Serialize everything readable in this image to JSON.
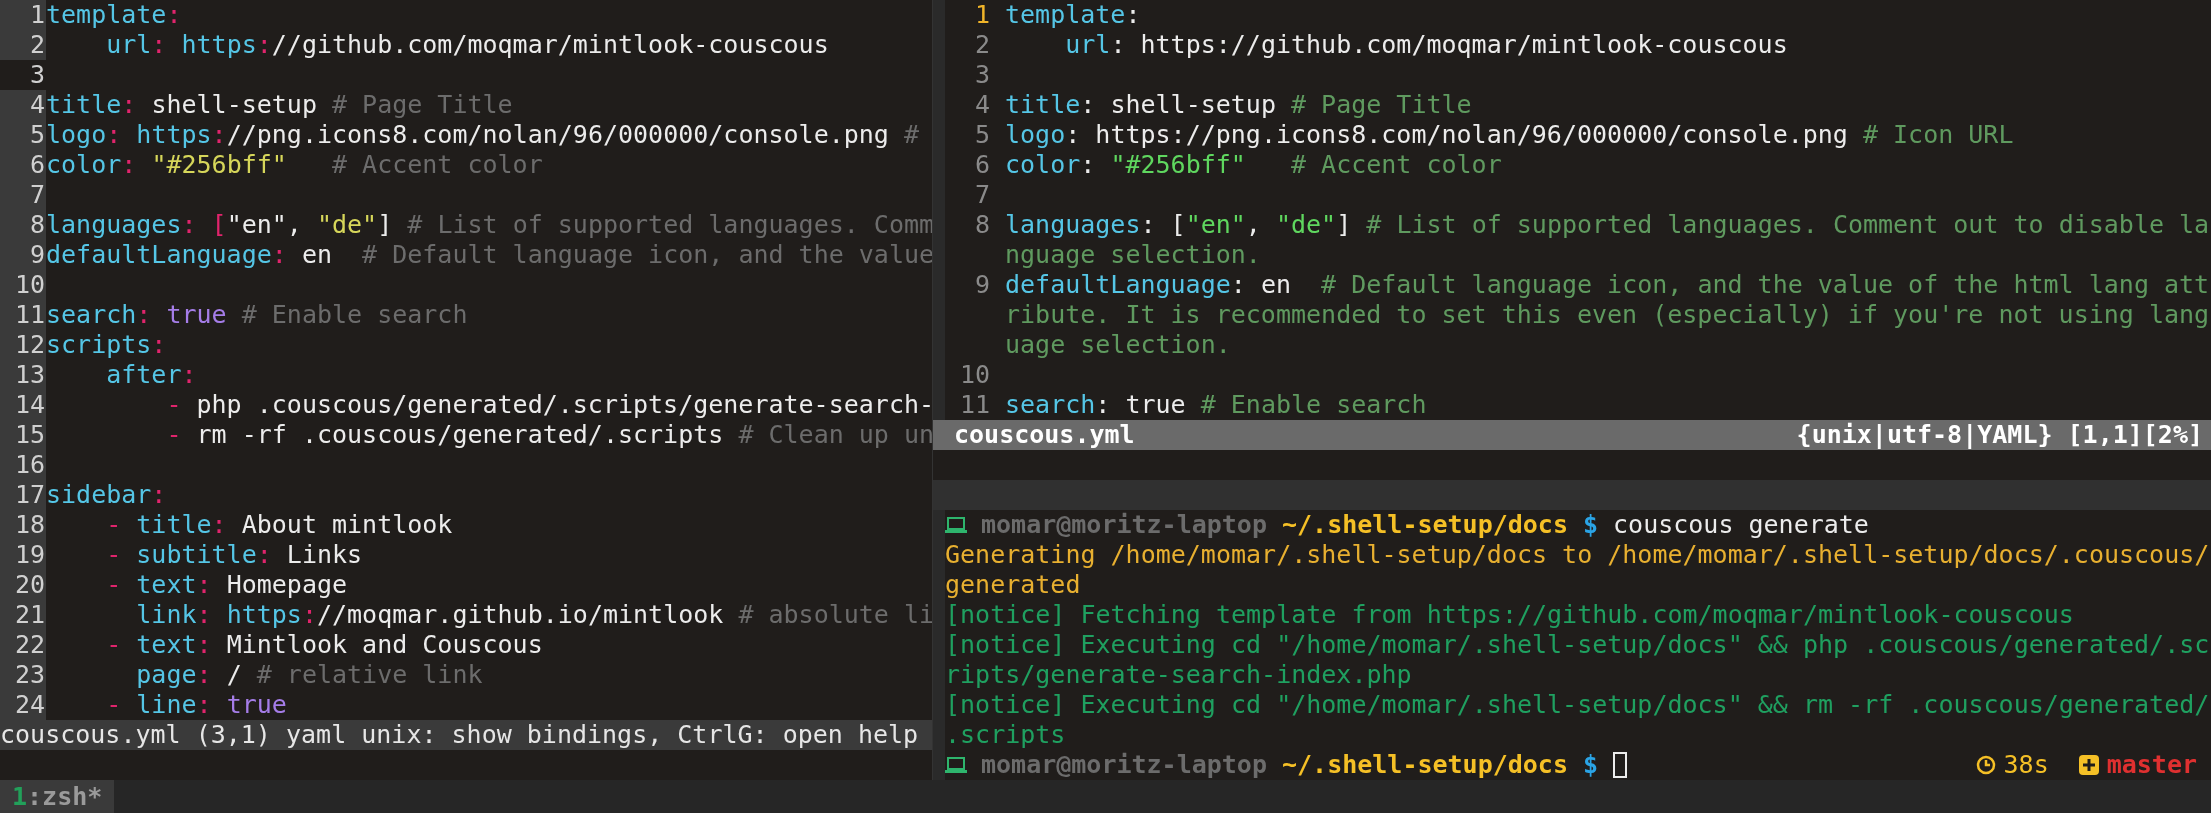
{
  "left_editor": {
    "lines": [
      {
        "number": "1",
        "current": false,
        "tokens": [
          {
            "kind": "key",
            "text": "template"
          },
          {
            "kind": "punct",
            "text": ":"
          }
        ]
      },
      {
        "number": "2",
        "current": false,
        "tokens": [
          {
            "kind": "key",
            "text": "    url"
          },
          {
            "kind": "punct",
            "text": ":"
          },
          {
            "kind": "key",
            "text": " https"
          },
          {
            "kind": "punct",
            "text": ":"
          },
          {
            "kind": "text",
            "text": "//github.com/moqmar/mintlook-couscous"
          }
        ]
      },
      {
        "number": "3",
        "current": true
      },
      {
        "number": "4",
        "current": false,
        "tokens": [
          {
            "kind": "key",
            "text": "title"
          },
          {
            "kind": "punct",
            "text": ":"
          },
          {
            "kind": "text",
            "text": " shell-setup "
          },
          {
            "kind": "comment",
            "text": "# Page Title"
          }
        ]
      },
      {
        "number": "5",
        "current": false,
        "tokens": [
          {
            "kind": "key",
            "text": "logo"
          },
          {
            "kind": "punct",
            "text": ":"
          },
          {
            "kind": "key",
            "text": " https"
          },
          {
            "kind": "punct",
            "text": ":"
          },
          {
            "kind": "text",
            "text": "//png.icons8.com/nolan/96/000000/console.png "
          },
          {
            "kind": "comment",
            "text": "#"
          }
        ]
      },
      {
        "number": "6",
        "current": false,
        "tokens": [
          {
            "kind": "key",
            "text": "color"
          },
          {
            "kind": "punct",
            "text": ":"
          },
          {
            "kind": "string",
            "text": " \"#256bff\""
          },
          {
            "kind": "comment",
            "text": "   # Accent color"
          }
        ]
      },
      {
        "number": "7",
        "current": false
      },
      {
        "number": "8",
        "current": false,
        "tokens": [
          {
            "kind": "key",
            "text": "languages"
          },
          {
            "kind": "punct",
            "text": ":"
          },
          {
            "kind": "punct",
            "text": " ["
          },
          {
            "kind": "text",
            "text": "\"en\", "
          },
          {
            "kind": "string",
            "text": "\"de\""
          },
          {
            "kind": "text",
            "text": "] "
          },
          {
            "kind": "comment",
            "text": "# List of supported languages. Comm"
          }
        ]
      },
      {
        "number": "9",
        "current": false,
        "tokens": [
          {
            "kind": "key",
            "text": "defaultLanguage"
          },
          {
            "kind": "punct",
            "text": ":"
          },
          {
            "kind": "text",
            "text": " en  "
          },
          {
            "kind": "comment",
            "text": "# Default language icon, and the value"
          }
        ]
      },
      {
        "number": "10",
        "current": false
      },
      {
        "number": "11",
        "current": false,
        "tokens": [
          {
            "kind": "key",
            "text": "search"
          },
          {
            "kind": "punct",
            "text": ":"
          },
          {
            "kind": "bool",
            "text": " true"
          },
          {
            "kind": "comment",
            "text": " # Enable search"
          }
        ]
      },
      {
        "number": "12",
        "current": false,
        "tokens": [
          {
            "kind": "key",
            "text": "scripts"
          },
          {
            "kind": "punct",
            "text": ":"
          }
        ]
      },
      {
        "number": "13",
        "current": false,
        "tokens": [
          {
            "kind": "key",
            "text": "    after"
          },
          {
            "kind": "punct",
            "text": ":"
          }
        ]
      },
      {
        "number": "14",
        "current": false,
        "tokens": [
          {
            "kind": "punct",
            "text": "        -"
          },
          {
            "kind": "text",
            "text": " php .couscous/generated/.scripts/generate-search-"
          }
        ]
      },
      {
        "number": "15",
        "current": false,
        "tokens": [
          {
            "kind": "punct",
            "text": "        -"
          },
          {
            "kind": "text",
            "text": " rm -rf .couscous/generated/.scripts "
          },
          {
            "kind": "comment",
            "text": "# Clean up un"
          }
        ]
      },
      {
        "number": "16",
        "current": false
      },
      {
        "number": "17",
        "current": false,
        "tokens": [
          {
            "kind": "key",
            "text": "sidebar"
          },
          {
            "kind": "punct",
            "text": ":"
          }
        ]
      },
      {
        "number": "18",
        "current": false,
        "tokens": [
          {
            "kind": "punct",
            "text": "    -"
          },
          {
            "kind": "key",
            "text": " title"
          },
          {
            "kind": "punct",
            "text": ":"
          },
          {
            "kind": "text",
            "text": " About mintlook"
          }
        ]
      },
      {
        "number": "19",
        "current": false,
        "tokens": [
          {
            "kind": "punct",
            "text": "    -"
          },
          {
            "kind": "key",
            "text": " subtitle"
          },
          {
            "kind": "punct",
            "text": ":"
          },
          {
            "kind": "text",
            "text": " Links"
          }
        ]
      },
      {
        "number": "20",
        "current": false,
        "tokens": [
          {
            "kind": "punct",
            "text": "    -"
          },
          {
            "kind": "key",
            "text": " text"
          },
          {
            "kind": "punct",
            "text": ":"
          },
          {
            "kind": "text",
            "text": " Homepage"
          }
        ]
      },
      {
        "number": "21",
        "current": false,
        "tokens": [
          {
            "kind": "key",
            "text": "      link"
          },
          {
            "kind": "punct",
            "text": ":"
          },
          {
            "kind": "key",
            "text": " https"
          },
          {
            "kind": "punct",
            "text": ":"
          },
          {
            "kind": "text",
            "text": "//moqmar.github.io/mintlook "
          },
          {
            "kind": "comment",
            "text": "# absolute li"
          }
        ]
      },
      {
        "number": "22",
        "current": false,
        "tokens": [
          {
            "kind": "punct",
            "text": "    -"
          },
          {
            "kind": "key",
            "text": " text"
          },
          {
            "kind": "punct",
            "text": ":"
          },
          {
            "kind": "text",
            "text": " Mintlook and Couscous"
          }
        ]
      },
      {
        "number": "23",
        "current": false,
        "tokens": [
          {
            "kind": "key",
            "text": "      page"
          },
          {
            "kind": "punct",
            "text": ":"
          },
          {
            "kind": "text",
            "text": " / "
          },
          {
            "kind": "comment",
            "text": "# relative link"
          }
        ]
      },
      {
        "number": "24",
        "current": false,
        "tokens": [
          {
            "kind": "punct",
            "text": "    -"
          },
          {
            "kind": "key",
            "text": " line"
          },
          {
            "kind": "punct",
            "text": ":"
          },
          {
            "kind": "bool",
            "text": " true"
          }
        ]
      }
    ],
    "status": "couscous.yml (3,1) yaml unix: show bindings, CtrlG: open help"
  },
  "right_editor": {
    "lines": [
      {
        "number": "1",
        "current": true,
        "tokens": [
          {
            "kind": "key",
            "text": "template"
          },
          {
            "kind": "punct",
            "text": ":"
          }
        ]
      },
      {
        "number": "2",
        "current": false,
        "tokens": [
          {
            "kind": "key",
            "text": "    url"
          },
          {
            "kind": "punct",
            "text": ":"
          },
          {
            "kind": "text",
            "text": " https://github.com/moqmar/mintlook-couscous"
          }
        ]
      },
      {
        "number": "3",
        "current": false
      },
      {
        "number": "4",
        "current": false,
        "tokens": [
          {
            "kind": "key",
            "text": "title"
          },
          {
            "kind": "punct",
            "text": ":"
          },
          {
            "kind": "text",
            "text": " shell-setup "
          },
          {
            "kind": "comment",
            "text": "# Page Title"
          }
        ]
      },
      {
        "number": "5",
        "current": false,
        "tokens": [
          {
            "kind": "key",
            "text": "logo"
          },
          {
            "kind": "punct",
            "text": ":"
          },
          {
            "kind": "text",
            "text": " https://png.icons8.com/nolan/96/000000/console.png "
          },
          {
            "kind": "comment",
            "text": "# Icon URL"
          }
        ]
      },
      {
        "number": "6",
        "current": false,
        "tokens": [
          {
            "kind": "key",
            "text": "color"
          },
          {
            "kind": "punct",
            "text": ":"
          },
          {
            "kind": "string",
            "text": " \"#256bff\""
          },
          {
            "kind": "comment",
            "text": "   # Accent color"
          }
        ]
      },
      {
        "number": "7",
        "current": false
      },
      {
        "number": "8",
        "current": false,
        "tokens": [
          {
            "kind": "key",
            "text": "languages"
          },
          {
            "kind": "punct",
            "text": ":"
          },
          {
            "kind": "text",
            "text": " ["
          },
          {
            "kind": "string",
            "text": "\"en\""
          },
          {
            "kind": "text",
            "text": ", "
          },
          {
            "kind": "string",
            "text": "\"de\""
          },
          {
            "kind": "text",
            "text": "] "
          },
          {
            "kind": "comment",
            "text": "# List of supported languages. Comment out to disable language selection."
          }
        ]
      },
      {
        "number": "9",
        "current": false,
        "tokens": [
          {
            "kind": "key",
            "text": "defaultLanguage"
          },
          {
            "kind": "punct",
            "text": ":"
          },
          {
            "kind": "text",
            "text": " en  "
          },
          {
            "kind": "comment",
            "text": "# Default language icon, and the value of the html lang attribute. It is recommended to set this even (especially) if you're not using language selection."
          }
        ]
      },
      {
        "number": "10",
        "current": false
      },
      {
        "number": "11",
        "current": false,
        "tokens": [
          {
            "kind": "key",
            "text": "search"
          },
          {
            "kind": "punct",
            "text": ":"
          },
          {
            "kind": "text",
            "text": " true "
          },
          {
            "kind": "comment",
            "text": "# Enable search"
          }
        ]
      }
    ],
    "status": {
      "file": "couscous.yml",
      "info": "{unix|utf-8|YAML} [1,1][2%]"
    }
  },
  "terminal": {
    "lines": [
      {
        "kind": "prompt",
        "user": "momar@moritz-laptop",
        "path": "~/.shell-setup/docs",
        "symbol": "$",
        "command": "couscous generate"
      },
      {
        "kind": "info",
        "text": "Generating /home/momar/.shell-setup/docs to /home/momar/.shell-setup/docs/.couscous/generated"
      },
      {
        "kind": "notice",
        "text": "[notice] Fetching template from https://github.com/moqmar/mintlook-couscous"
      },
      {
        "kind": "notice",
        "text": "[notice] Executing cd \"/home/momar/.shell-setup/docs\" && php .couscous/generated/.scripts/generate-search-index.php"
      },
      {
        "kind": "notice",
        "text": "[notice] Executing cd \"/home/momar/.shell-setup/docs\" && rm -rf .couscous/generated/.scripts"
      },
      {
        "kind": "prompt",
        "user": "momar@moritz-laptop",
        "path": "~/.shell-setup/docs",
        "symbol": "$",
        "cursor": true,
        "duration": "38s",
        "branch": "master"
      }
    ]
  },
  "tmux": {
    "windows": [
      {
        "index": "1",
        "label": ":zsh*",
        "selected": true
      }
    ]
  }
}
